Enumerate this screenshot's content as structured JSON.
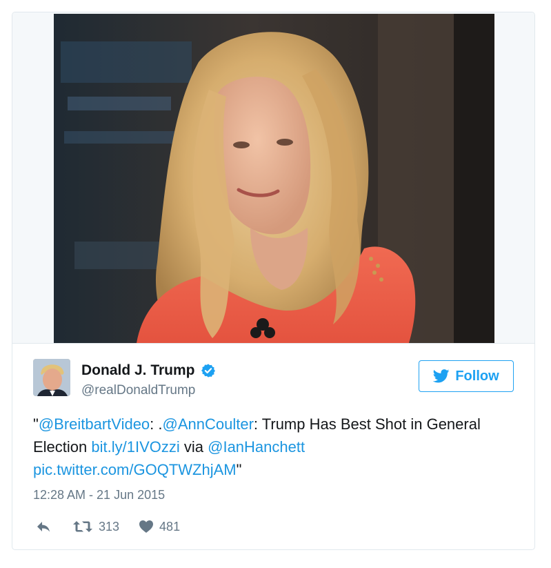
{
  "author": {
    "name": "Donald J. Trump",
    "handle": "@realDonaldTrump",
    "verified": true
  },
  "follow_button": {
    "label": "Follow",
    "color": "#1da1f2"
  },
  "tweet": {
    "open_quote": "\"",
    "mention_1": "@BreitbartVideo",
    "text_1": ": .",
    "mention_2": "@AnnCoulter",
    "text_2": ": Trump Has Best Shot in General Election ",
    "link": "bit.ly/1IVOzzi",
    "text_3": " via ",
    "mention_3": "@IanHanchett",
    "pic_link": "pic.twitter.com/GOQTWZhjAM",
    "close_quote": "\"",
    "link_color": "#1b95e0"
  },
  "timestamp": "12:28 AM - 21 Jun 2015",
  "actions": {
    "reply_icon": "reply-icon",
    "retweet_icon": "retweet-icon",
    "retweet_count": "313",
    "like_icon": "heart-icon",
    "like_count": "481"
  },
  "media": {
    "description_icon": "photo-of-woman-with-long-blonde-hair-in-coral-dress"
  }
}
